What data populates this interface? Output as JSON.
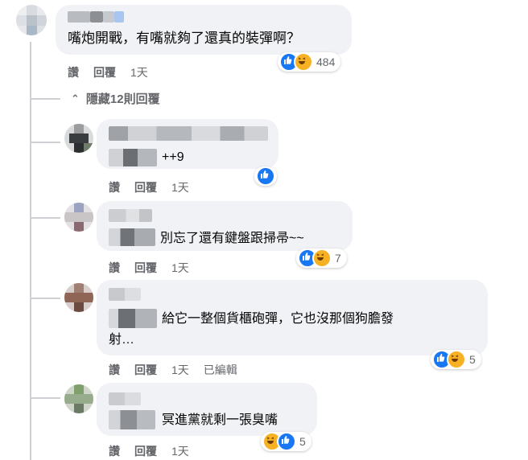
{
  "colors": {
    "like": "#1877f2",
    "haha": "#f7b125",
    "bubble": "#f0f2f5",
    "meta": "#65676b"
  },
  "main_comment": {
    "text": "嘴炮開戰，有嘴就夠了還真的裝彈啊？",
    "actions": {
      "like": "讚",
      "reply": "回覆",
      "time": "1天"
    },
    "reactions": {
      "icons": [
        "like-icon",
        "haha-icon"
      ],
      "count": "484"
    }
  },
  "hide_replies": "隱藏12則回覆",
  "replies": [
    {
      "text": "++9",
      "actions": {
        "like": "讚",
        "reply": "回覆",
        "time": "1天"
      },
      "reactions": {
        "icons": [
          "like-icon"
        ],
        "count": ""
      }
    },
    {
      "text": "別忘了還有鍵盤跟掃帚~~",
      "actions": {
        "like": "讚",
        "reply": "回覆",
        "time": "1天"
      },
      "reactions": {
        "icons": [
          "like-icon",
          "haha-icon"
        ],
        "count": "7"
      }
    },
    {
      "text_line1": "給它一整個貨櫃砲彈，它也沒那個狗膽發",
      "text_line2": "射…",
      "actions": {
        "like": "讚",
        "reply": "回覆",
        "time": "1天",
        "edited": "已編輯"
      },
      "reactions": {
        "icons": [
          "like-icon",
          "haha-icon"
        ],
        "count": "5"
      }
    },
    {
      "text": "冥進黨就剩一張臭嘴",
      "actions": {
        "like": "讚",
        "reply": "回覆",
        "time": "1天"
      },
      "reactions": {
        "icons": [
          "haha-icon",
          "like-icon"
        ],
        "count": "5"
      }
    }
  ]
}
